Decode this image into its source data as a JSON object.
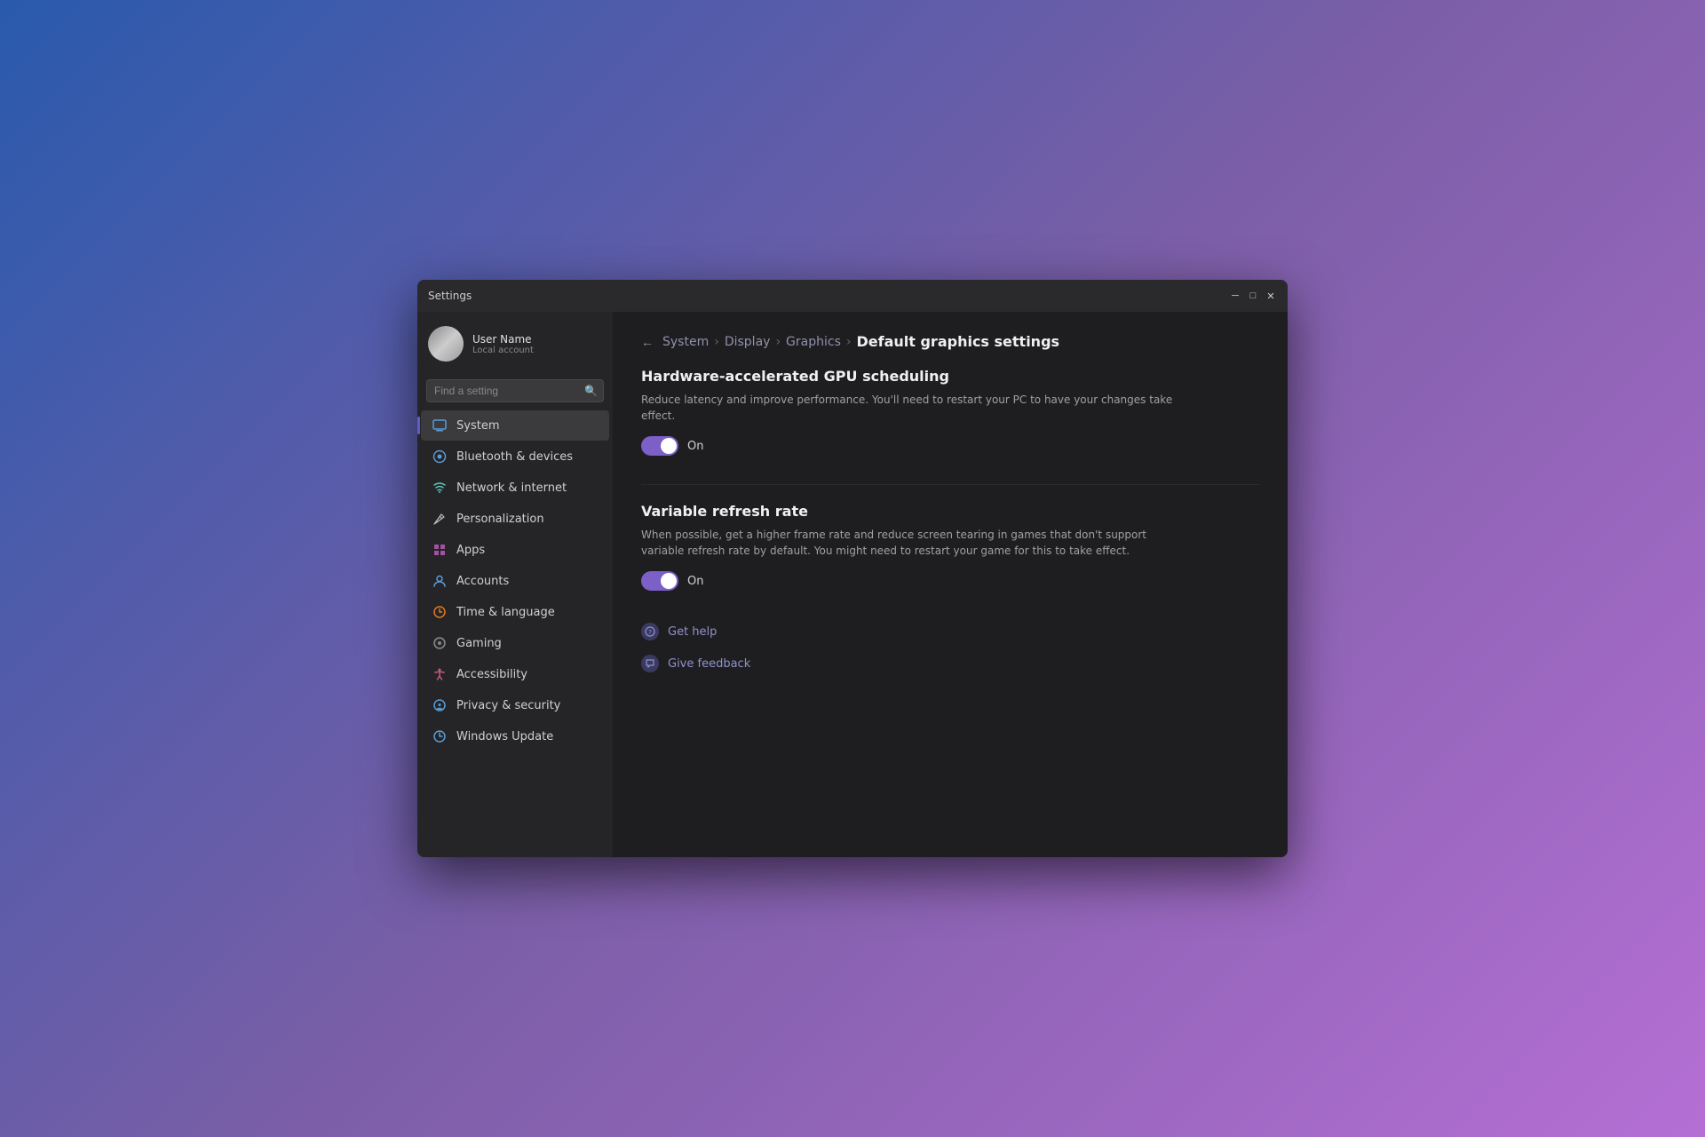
{
  "window": {
    "title": "Settings",
    "controls": {
      "minimize": "─",
      "maximize": "□",
      "close": "✕"
    }
  },
  "user": {
    "name": "User Name",
    "sub": "Local account"
  },
  "search": {
    "placeholder": "Find a setting"
  },
  "sidebar": {
    "items": [
      {
        "id": "system",
        "label": "System",
        "icon": "🖥",
        "active": true
      },
      {
        "id": "bluetooth",
        "label": "Bluetooth & devices",
        "icon": "◉",
        "active": false
      },
      {
        "id": "network",
        "label": "Network & internet",
        "icon": "◈",
        "active": false
      },
      {
        "id": "personalization",
        "label": "Personalization",
        "icon": "✏",
        "active": false
      },
      {
        "id": "apps",
        "label": "Apps",
        "icon": "▦",
        "active": false
      },
      {
        "id": "accounts",
        "label": "Accounts",
        "icon": "◎",
        "active": false
      },
      {
        "id": "time",
        "label": "Time & language",
        "icon": "⊕",
        "active": false
      },
      {
        "id": "gaming",
        "label": "Gaming",
        "icon": "◈",
        "active": false
      },
      {
        "id": "accessibility",
        "label": "Accessibility",
        "icon": "✳",
        "active": false
      },
      {
        "id": "privacy",
        "label": "Privacy & security",
        "icon": "◉",
        "active": false
      },
      {
        "id": "update",
        "label": "Windows Update",
        "icon": "◉",
        "active": false
      }
    ]
  },
  "breadcrumb": {
    "items": [
      "System",
      "Display",
      "Graphics"
    ],
    "current": "Default graphics settings",
    "separator": "›"
  },
  "sections": [
    {
      "id": "gpu-scheduling",
      "title": "Hardware-accelerated GPU scheduling",
      "description": "Reduce latency and improve performance. You'll need to restart your PC to have your changes take effect.",
      "toggle": {
        "state": "On",
        "enabled": true
      }
    },
    {
      "id": "variable-refresh",
      "title": "Variable refresh rate",
      "description": "When possible, get a higher frame rate and reduce screen tearing in games that don't support variable refresh rate by default. You might need to restart your game for this to take effect.",
      "toggle": {
        "state": "On",
        "enabled": true
      }
    }
  ],
  "help": {
    "links": [
      {
        "id": "get-help",
        "label": "Get help"
      },
      {
        "id": "give-feedback",
        "label": "Give feedback"
      }
    ]
  }
}
